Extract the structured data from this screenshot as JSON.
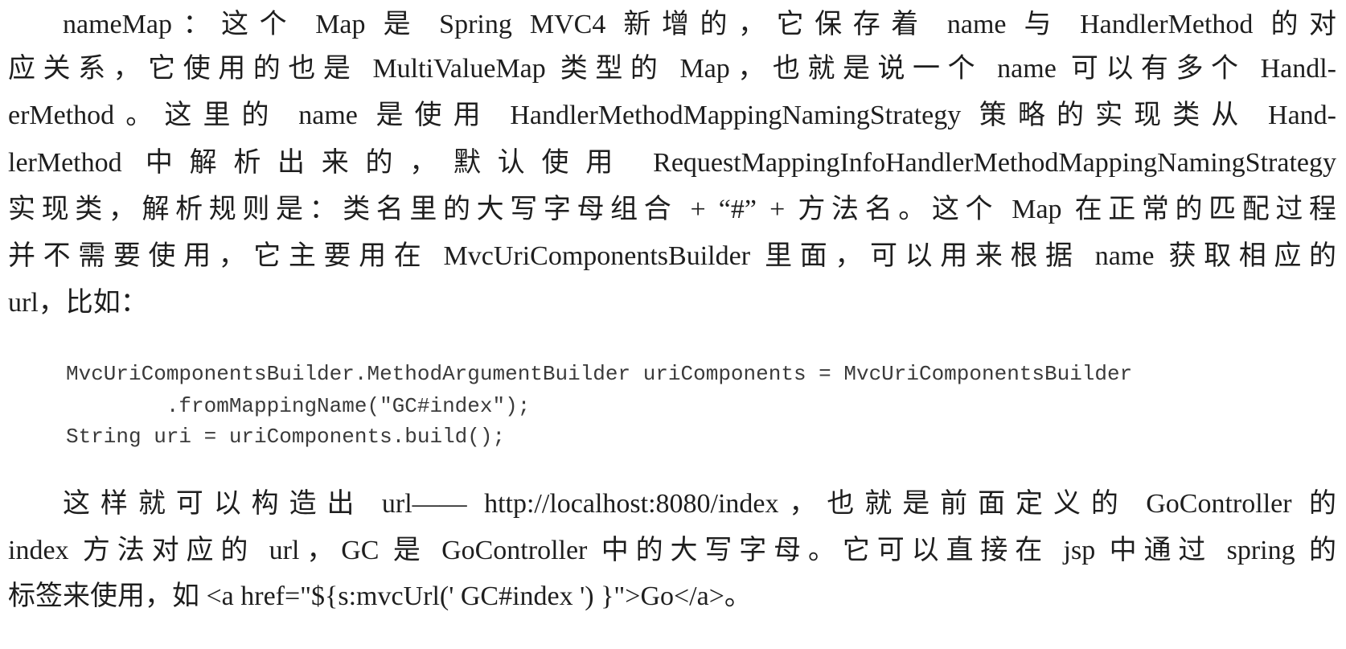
{
  "paragraph1": {
    "lines": [
      "nameMap：这个 Map 是 Spring MVC4 新增的，它保存着 name 与 HandlerMethod 的对",
      "应关系，它使用的也是 MultiValueMap 类型的 Map，也就是说一个 name 可以有多个 Handl-",
      "erMethod。这里的 name 是使用 HandlerMethodMappingNamingStrategy 策略的实现类从 Hand-",
      "lerMethod 中解析出来的，默认使用 RequestMappingInfoHandlerMethodMappingNamingStrategy",
      "实现类，解析规则是：类名里的大写字母组合 + “#” + 方法名。这个 Map 在正常的匹配过程",
      "并不需要使用，它主要用在 MvcUriComponentsBuilder 里面，可以用来根据 name 获取相应的",
      "url，比如："
    ]
  },
  "code": {
    "lines": [
      "MvcUriComponentsBuilder.MethodArgumentBuilder uriComponents = MvcUriComponentsBuilder",
      "        .fromMappingName(\"GC#index\");",
      "String uri = uriComponents.build();"
    ]
  },
  "paragraph2": {
    "lines": [
      "这样就可以构造出 url—— http://localhost:8080/index，也就是前面定义的 GoController 的",
      "index 方法对应的 url，GC 是 GoController 中的大写字母。它可以直接在 jsp 中通过 spring 的",
      "标签来使用，如 <a href=\"${s:mvcUrl(' GC#index ') }\">Go</a>。"
    ]
  }
}
